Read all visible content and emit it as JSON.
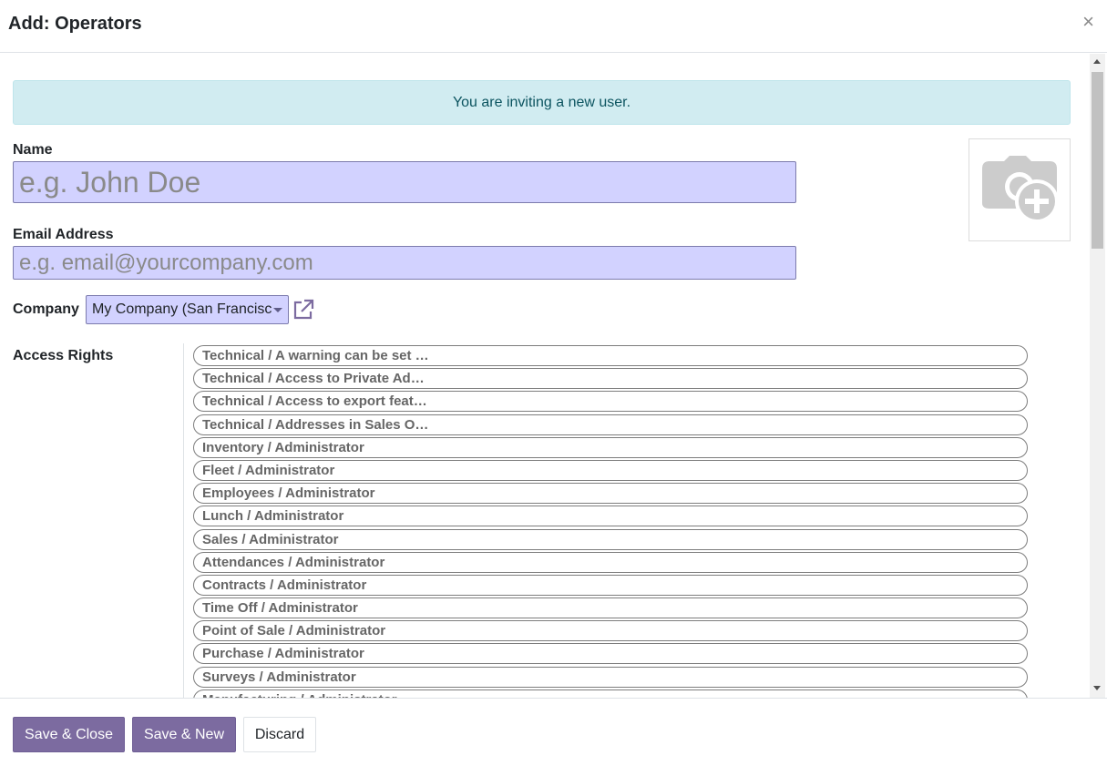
{
  "dialog": {
    "title": "Add: Operators",
    "close_label": "×"
  },
  "alert": {
    "text": "You are inviting a new user."
  },
  "form": {
    "name_label": "Name",
    "name_placeholder": "e.g. John Doe",
    "email_label": "Email Address",
    "email_placeholder": "e.g. email@yourcompany.com",
    "company_label": "Company",
    "company_value": "My Company (San Francisco)",
    "access_rights_label": "Access Rights"
  },
  "access_rights": [
    "Technical / A warning can be set …",
    "Technical / Access to Private Ad…",
    "Technical / Access to export feat…",
    "Technical / Addresses in Sales O…",
    "Inventory / Administrator",
    "Fleet / Administrator",
    "Employees / Administrator",
    "Lunch / Administrator",
    "Sales / Administrator",
    "Attendances / Administrator",
    "Contracts / Administrator",
    "Time Off / Administrator",
    "Point of Sale / Administrator",
    "Purchase / Administrator",
    "Surveys / Administrator",
    "Manufacturing / Administrator"
  ],
  "footer": {
    "save_close": "Save & Close",
    "save_new": "Save & New",
    "discard": "Discard"
  },
  "colors": {
    "primary": "#7c6ba0",
    "input_bg": "#d2d2ff",
    "alert_bg": "#d1ecf1",
    "alert_text": "#0c5460"
  },
  "icons": {
    "close": "close-icon",
    "external_link": "external-link-icon",
    "avatar": "camera-plus-icon",
    "dropdown": "caret-down-icon"
  }
}
